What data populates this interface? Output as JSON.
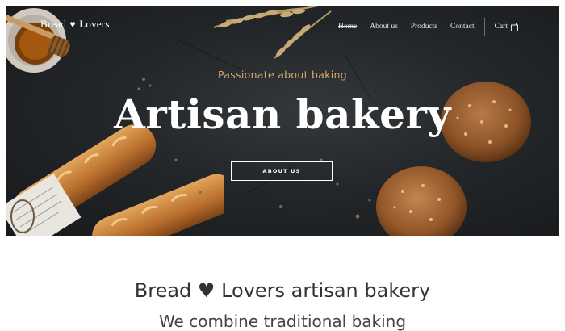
{
  "brand": {
    "name_left": "Bread",
    "heart": "♥",
    "name_right": "Lovers"
  },
  "nav": {
    "items": [
      {
        "label": "Home"
      },
      {
        "label": "About us"
      },
      {
        "label": "Products"
      },
      {
        "label": "Contact"
      }
    ],
    "cart_label": "Cart",
    "cart_icon": "shopping-bag-icon"
  },
  "hero": {
    "tagline": "Passionate about baking",
    "title": "Artisan bakery",
    "cta_label": "ABOUT US"
  },
  "intro": {
    "title": "Bread ♥ Lovers artisan bakery",
    "subtitle": "We combine traditional baking"
  },
  "colors": {
    "accent": "#d7a86e",
    "hero_bg": "#24272a",
    "text_dark": "#333333"
  }
}
